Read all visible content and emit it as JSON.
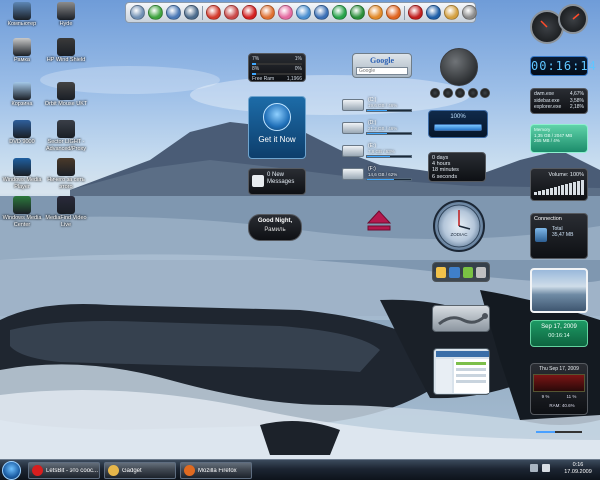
{
  "desktop_icons": [
    {
      "label": "Компьютер",
      "color": "#5d87b5"
    },
    {
      "label": "Hyde",
      "color": "#8c8c8c"
    },
    {
      "label": "Рамка",
      "color": "#c9c9c9"
    },
    {
      "label": "HP Wind Shield",
      "color": "#3a3a3a"
    },
    {
      "label": "Корзина",
      "color": "#a4c9e9"
    },
    {
      "label": "Orbit Mouse UKT",
      "color": "#444444"
    },
    {
      "label": "DVD 9000",
      "color": "#2f5f9c"
    },
    {
      "label": "Sector LIGHT - Advanced/Proxy",
      "color": "#3a3f48"
    },
    {
      "label": "Windows Media Player",
      "color": "#1f5fa0"
    },
    {
      "label": "Ничего за сеть этого",
      "color": "#4a3a2a"
    },
    {
      "label": "Windows Media Center",
      "color": "#2d7a3d"
    },
    {
      "label": "MediaFind Video Live",
      "color": "#2a2a3a"
    }
  ],
  "quickbar_icons": [
    {
      "name": "computer-icon",
      "color": "#6f8fb3"
    },
    {
      "name": "plus-icon",
      "color": "#3fa33f"
    },
    {
      "name": "gadgets-icon",
      "color": "#4a78b5"
    },
    {
      "name": "desktop-icon",
      "color": "#4b6b8c"
    },
    {
      "name": "alert-icon",
      "color": "#d33a2c"
    },
    {
      "name": "graph-icon",
      "color": "#c94848"
    },
    {
      "name": "opera-icon",
      "color": "#d32020"
    },
    {
      "name": "network-icon",
      "color": "#e07030"
    },
    {
      "name": "pinwheel-icon",
      "color": "#e46aa0"
    },
    {
      "name": "arrow-icon",
      "color": "#4a8fd0"
    },
    {
      "name": "media-icon",
      "color": "#3a6fb5"
    },
    {
      "name": "compass-icon",
      "color": "#27a34a"
    },
    {
      "name": "globe-icon",
      "color": "#2a8f3a"
    },
    {
      "name": "orange-icon",
      "color": "#e28a2a"
    },
    {
      "name": "firefox-icon",
      "color": "#e06420"
    },
    {
      "name": "pdf-icon",
      "color": "#c11f1f"
    },
    {
      "name": "photoshop-icon",
      "color": "#1f5fa8"
    },
    {
      "name": "avatar-icon",
      "color": "#d4a040"
    },
    {
      "name": "settings-icon",
      "color": "#8a8a8a"
    }
  ],
  "ram_gadget": {
    "rows": [
      {
        "label": "7%",
        "value": "1%"
      },
      {
        "label": "8%",
        "value": "0%"
      }
    ],
    "free_label": "Free Ram",
    "free_value": "1,1966"
  },
  "getit": {
    "label": "Get it Now"
  },
  "messages": {
    "count": "0 New",
    "label": "Messages"
  },
  "night": {
    "greeting": "Good Night,",
    "name": "Рамиль"
  },
  "google": {
    "logo": "Google",
    "placeholder": "Google"
  },
  "drives": [
    {
      "name": "(C:)",
      "info": "19,6 GB / 46%",
      "fill": 0.46
    },
    {
      "name": "(D:)",
      "info": "21,2 GB / 46%",
      "fill": 0.46
    },
    {
      "name": "(E:)",
      "info": "7,8 GB / 53%",
      "fill": 0.53
    },
    {
      "name": "(F:)",
      "info": "14,6 GB / 62%",
      "fill": 0.62
    }
  ],
  "battery": {
    "percent": "100%",
    "fill": 1.0
  },
  "uptime": [
    "0 days",
    "4 hours",
    "18 minutes",
    "6 seconds"
  ],
  "zodiac": {
    "label": "ZODIAC"
  },
  "digital_clock": {
    "time": "00:16:14"
  },
  "processes": [
    {
      "name": "dwm.exe",
      "value": "4,67%"
    },
    {
      "name": "sidebar.exe",
      "value": "3,58%"
    },
    {
      "name": "explorer.exe",
      "value": "2,18%"
    }
  ],
  "memory": {
    "lines": [
      "Memory",
      "1,35 GB / 2047 MB",
      "265 MB / 4%"
    ]
  },
  "volume": {
    "label": "Volume: 100%",
    "bars": [
      3,
      4,
      5,
      6,
      7,
      8,
      9,
      10,
      11,
      12,
      13,
      14,
      15
    ]
  },
  "connection": {
    "title": "Connection",
    "total_label": "Total",
    "total_value": "35,47 MB"
  },
  "calendar": {
    "date": "Sep 17, 2009",
    "time": "00:16:14"
  },
  "weather": {
    "date": "Thu Sep 17, 2009",
    "left": "9 %",
    "right": "11 %",
    "ram": "RAM: 40.6%",
    "ram_fill": 0.406
  },
  "taskbar": {
    "buttons": [
      {
        "label": "LetsBit - это соос...",
        "color": "#d81e1e"
      },
      {
        "label": "Gadget",
        "color": "#e6b64a"
      },
      {
        "label": "Mozilla Firefox",
        "color": "#e06a20"
      }
    ],
    "clock_time": "0:16",
    "clock_date": "17.09.2009"
  }
}
